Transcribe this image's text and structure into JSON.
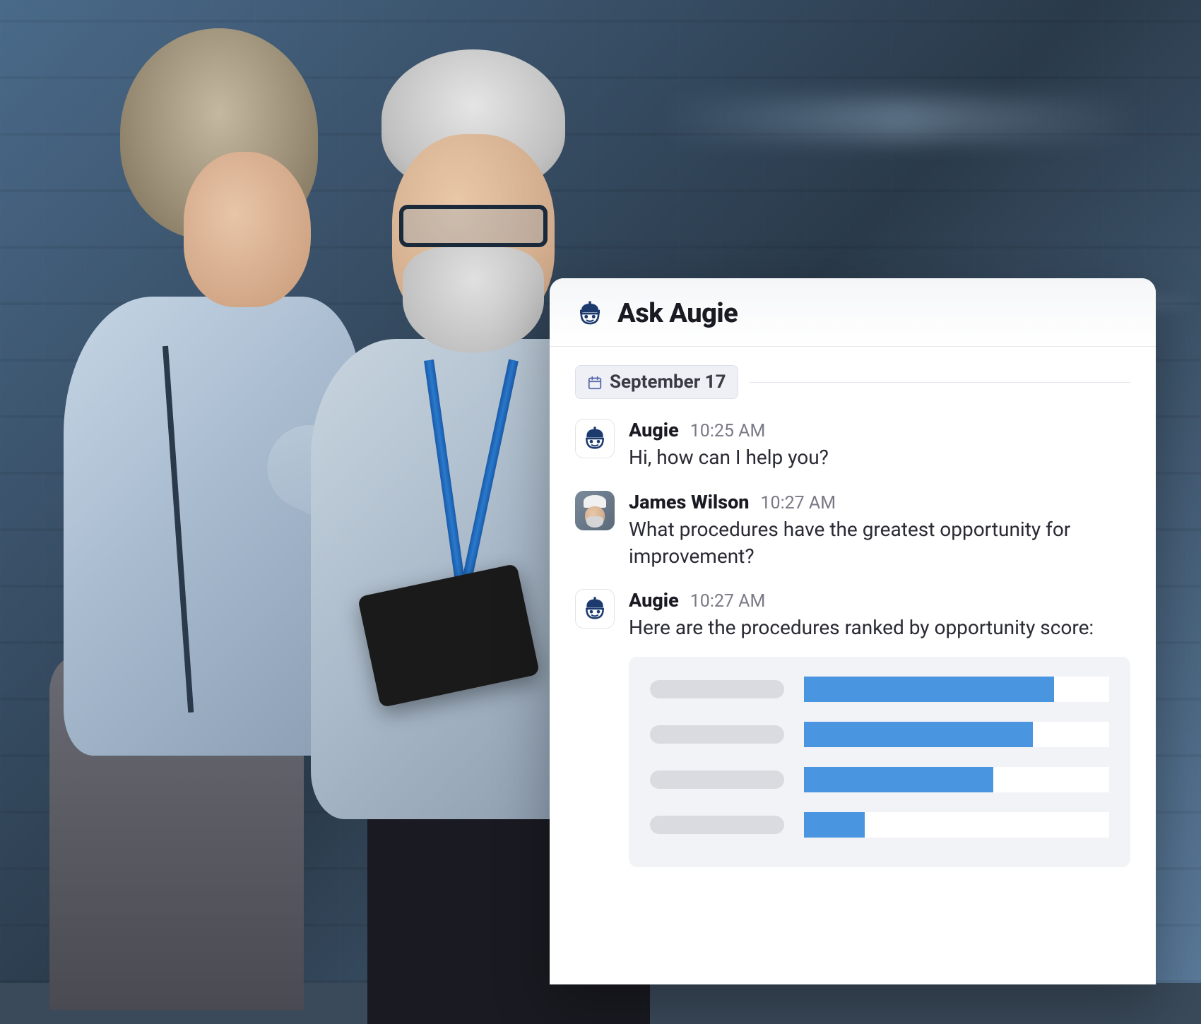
{
  "chat": {
    "title": "Ask Augie",
    "date_label": "September 17",
    "messages": [
      {
        "sender": "Augie",
        "time": "10:25 AM",
        "text": "Hi, how can I help you?",
        "avatar": "bot"
      },
      {
        "sender": "James Wilson",
        "time": "10:27 AM",
        "text": "What procedures have the greatest opportunity for improvement?",
        "avatar": "human"
      },
      {
        "sender": "Augie",
        "time": "10:27 AM",
        "text": "Here are the procedures ranked by opportunity score:",
        "avatar": "bot"
      }
    ]
  },
  "chart_data": {
    "type": "bar",
    "title": "",
    "categories": [
      "",
      "",
      "",
      ""
    ],
    "values": [
      82,
      75,
      62,
      20
    ],
    "ylim": [
      0,
      100
    ],
    "bar_color": "#4a95e0"
  }
}
